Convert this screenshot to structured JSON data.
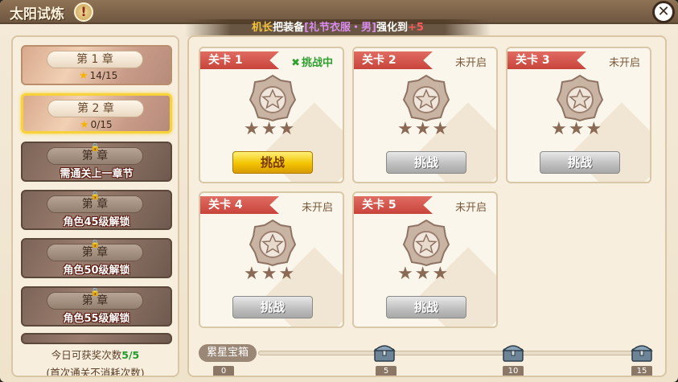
{
  "window": {
    "title": "太阳试炼",
    "info_icon": "!",
    "close_icon": "✕"
  },
  "notice": {
    "name": "机长",
    "verb": "把装备",
    "item": "[礼节衣服・男]",
    "suffix": "强化到",
    "level": "+5"
  },
  "chapters": [
    {
      "label": "第 1 章",
      "stars": "14/15",
      "locked": false
    },
    {
      "label": "第 2 章",
      "stars": "0/15",
      "locked": false,
      "selected": true
    },
    {
      "label": "第  章",
      "lock_text": "需通关上一章节",
      "locked": true
    },
    {
      "label": "第  章",
      "lock_text": "角色45级解锁",
      "locked": true
    },
    {
      "label": "第  章",
      "lock_text": "角色50级解锁",
      "locked": true
    },
    {
      "label": "第  章",
      "lock_text": "角色55级解锁",
      "locked": true
    }
  ],
  "sidebar_footer": {
    "line1_prefix": "今日可获奖次数",
    "count": "5/5",
    "line2": "(首次通关不消耗次数)"
  },
  "stages": [
    {
      "tag": "关卡 1",
      "status": "挑战中",
      "status_active": true,
      "button": "挑战",
      "button_style": "gold"
    },
    {
      "tag": "关卡 2",
      "status": "未开启",
      "status_active": false,
      "button": "挑战",
      "button_style": "grey"
    },
    {
      "tag": "关卡 3",
      "status": "未开启",
      "status_active": false,
      "button": "挑战",
      "button_style": "grey"
    },
    {
      "tag": "关卡 4",
      "status": "未开启",
      "status_active": false,
      "button": "挑战",
      "button_style": "grey"
    },
    {
      "tag": "关卡 5",
      "status": "未开启",
      "status_active": false,
      "button": "挑战",
      "button_style": "grey"
    }
  ],
  "stars_glyph": "★★★",
  "accum": {
    "label": "累星宝箱",
    "progress_fraction": 0,
    "ticks": [
      "0",
      "5",
      "10",
      "15"
    ]
  },
  "colors": {
    "accent_gold": "#f2c400",
    "stage_tag_red": "#c8443c",
    "active_green": "#2ea02e"
  }
}
